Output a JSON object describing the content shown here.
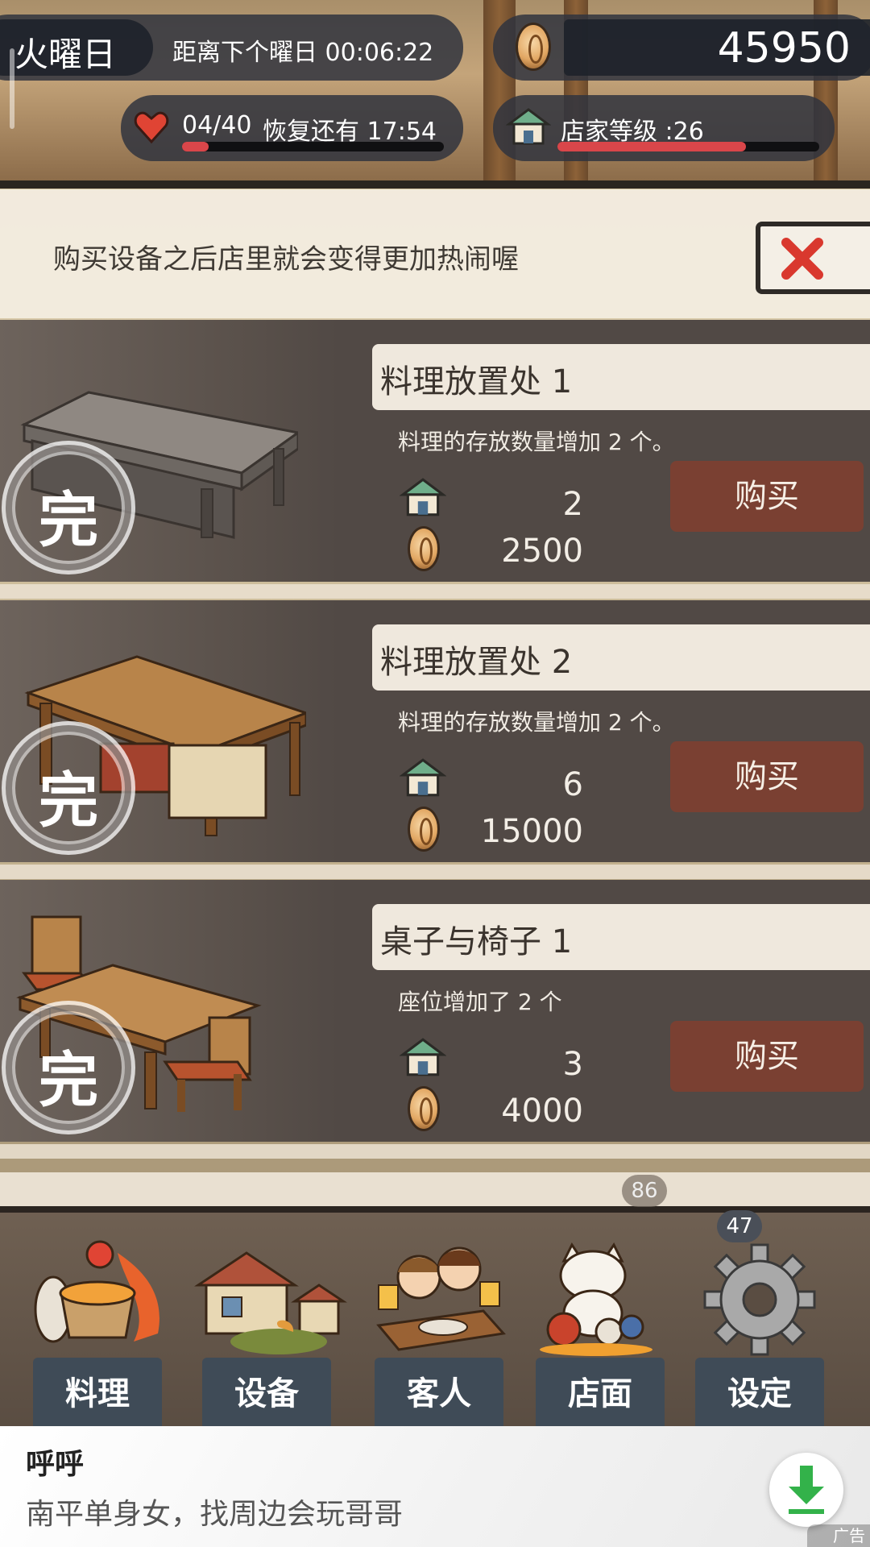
{
  "hud": {
    "day": "火曜日",
    "next_day_label": "距离下个曜日 00:06:22",
    "money": "45950",
    "stamina": "04/40",
    "recover_label": "恢复还有 17:54",
    "shop_level": "店家等级 :26",
    "stamina_fraction": 0.1,
    "level_fraction": 0.72
  },
  "panel": {
    "message": "购买设备之后店里就会变得更加热闹喔"
  },
  "items": [
    {
      "title": "料理放置处 1",
      "desc": "料理的存放数量增加 2 个。",
      "level": "2",
      "price": "2500",
      "buy": "购买",
      "status": "完"
    },
    {
      "title": "料理放置处 2",
      "desc": "料理的存放数量增加 2 个。",
      "level": "6",
      "price": "15000",
      "buy": "购买",
      "status": "完"
    },
    {
      "title": "桌子与椅子 1",
      "desc": "座位增加了 2 个",
      "level": "3",
      "price": "4000",
      "buy": "购买",
      "status": "完"
    }
  ],
  "scene": {
    "badge1": "86",
    "badge2": "47"
  },
  "tabs": [
    {
      "label": "料理"
    },
    {
      "label": "设备"
    },
    {
      "label": "客人"
    },
    {
      "label": "店面"
    },
    {
      "label": "设定"
    }
  ],
  "ad": {
    "title": "呼呼",
    "text": "南平单身女，找周边会玩哥哥",
    "tag": "广告"
  },
  "colors": {
    "accent_red": "#7a4032",
    "bar_red": "#d9464a",
    "card_bg": "#514945"
  }
}
